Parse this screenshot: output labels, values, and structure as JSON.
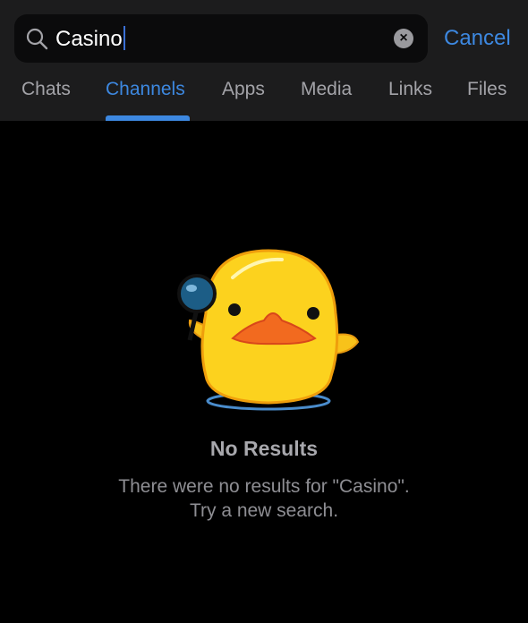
{
  "search": {
    "value": "Casino",
    "clear_icon": "x-circle-icon",
    "search_icon": "magnifier-icon"
  },
  "cancel_label": "Cancel",
  "tabs": [
    {
      "label": "Chats",
      "active": false
    },
    {
      "label": "Channels",
      "active": true
    },
    {
      "label": "Apps",
      "active": false
    },
    {
      "label": "Media",
      "active": false
    },
    {
      "label": "Links",
      "active": false
    },
    {
      "label": "Files",
      "active": false
    }
  ],
  "empty_state": {
    "title": "No Results",
    "line1": "There were no results for \"Casino\".",
    "line2": "Try a new search."
  },
  "colors": {
    "accent": "#3d88e0",
    "header_bg": "#1c1c1d",
    "background": "#000000"
  }
}
